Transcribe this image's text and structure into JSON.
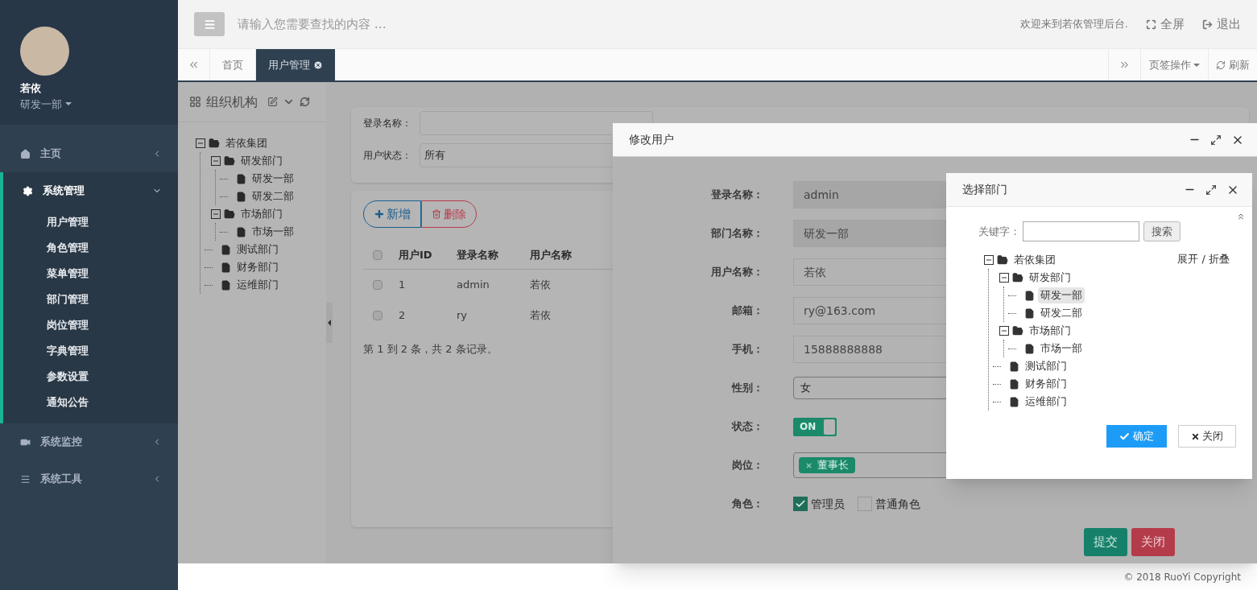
{
  "sidebar": {
    "user": {
      "name": "若依",
      "dept": "研发一部"
    },
    "menu": [
      {
        "label": "主页",
        "expanded": false
      },
      {
        "label": "系统管理",
        "expanded": true,
        "children": [
          {
            "label": "用户管理"
          },
          {
            "label": "角色管理"
          },
          {
            "label": "菜单管理"
          },
          {
            "label": "部门管理"
          },
          {
            "label": "岗位管理"
          },
          {
            "label": "字典管理"
          },
          {
            "label": "参数设置"
          },
          {
            "label": "通知公告"
          }
        ]
      },
      {
        "label": "系统监控",
        "expanded": false
      },
      {
        "label": "系统工具",
        "expanded": false
      }
    ]
  },
  "topbar": {
    "search": {
      "placeholder": "请输入您需要查找的内容 …"
    },
    "welcome": "欢迎来到若依管理后台.",
    "fullscreen": "全屏",
    "logout": "退出"
  },
  "tabs": [
    {
      "label": "首页",
      "selected": false
    },
    {
      "label": "用户管理",
      "selected": true
    }
  ],
  "tab_actions": {
    "tab_menu": "页签操作",
    "refresh": "刷新"
  },
  "org_panel": {
    "title": "组织机构",
    "tree": [
      {
        "label": "若依集团",
        "selected": false,
        "expanded": true,
        "children": [
          {
            "label": "研发部门",
            "selected": false,
            "expanded": true,
            "children": [
              {
                "label": "研发一部",
                "selected": false
              },
              {
                "label": "研发二部",
                "selected": false
              }
            ]
          },
          {
            "label": "市场部门",
            "selected": false,
            "expanded": true,
            "children": [
              {
                "label": "市场一部",
                "selected": false
              }
            ]
          },
          {
            "label": "测试部门",
            "selected": false
          },
          {
            "label": "财务部门",
            "selected": false
          },
          {
            "label": "运维部门",
            "selected": false
          }
        ]
      }
    ]
  },
  "search_form": {
    "fields": [
      {
        "label": "登录名称："
      },
      {
        "label": "用户状态：",
        "value": "所有"
      }
    ]
  },
  "toolbar": {
    "add": "新增",
    "delete": "删除"
  },
  "table": {
    "header_checked": false,
    "columns": [
      "用户ID",
      "登录名称",
      "用户名称"
    ],
    "rows": [
      {
        "checked": false,
        "cells": [
          "1",
          "admin",
          "若依"
        ]
      },
      {
        "checked": false,
        "cells": [
          "2",
          "ry",
          "若依"
        ]
      }
    ]
  },
  "pagination": "第 1 到 2 条，共 2 条记录。",
  "edit_dialog": {
    "title": "修改用户",
    "fields": [
      {
        "kind": "text",
        "label": "登录名称：",
        "value": "admin",
        "disabled": true
      },
      {
        "kind": "text",
        "label": "部门名称：",
        "value": "研发一部",
        "disabled": true
      },
      {
        "kind": "text",
        "label": "用户名称：",
        "value": "若依",
        "disabled": false
      },
      {
        "kind": "text",
        "label": "邮箱：",
        "value": "ry@163.com",
        "disabled": false
      },
      {
        "kind": "text",
        "label": "手机：",
        "value": "15888888888",
        "disabled": false
      },
      {
        "kind": "select",
        "label": "性别：",
        "value": "女"
      },
      {
        "kind": "switch",
        "label": "状态：",
        "on": true,
        "text": "ON"
      },
      {
        "kind": "tags",
        "label": "岗位：",
        "tags": [
          "董事长"
        ]
      },
      {
        "kind": "checkboxes",
        "label": "角色：",
        "options": [
          {
            "label": "管理员",
            "checked": true
          },
          {
            "label": "普通角色",
            "checked": false
          }
        ]
      }
    ],
    "submit": "提交",
    "close": "关闭"
  },
  "dept_dialog": {
    "title": "选择部门",
    "keyword_label": "关键字：",
    "search_button": "搜索",
    "toggle": "展开 / 折叠",
    "tree": [
      {
        "label": "若依集团",
        "selected": false,
        "expanded": true,
        "children": [
          {
            "label": "研发部门",
            "selected": false,
            "expanded": true,
            "children": [
              {
                "label": "研发一部",
                "selected": true
              },
              {
                "label": "研发二部",
                "selected": false
              }
            ]
          },
          {
            "label": "市场部门",
            "selected": false,
            "expanded": true,
            "children": [
              {
                "label": "市场一部",
                "selected": false
              }
            ]
          },
          {
            "label": "测试部门",
            "selected": false
          },
          {
            "label": "财务部门",
            "selected": false
          },
          {
            "label": "运维部门",
            "selected": false
          }
        ]
      }
    ],
    "confirm": "确定",
    "close": "关闭"
  },
  "footer": "© 2018 RuoYi Copyright"
}
